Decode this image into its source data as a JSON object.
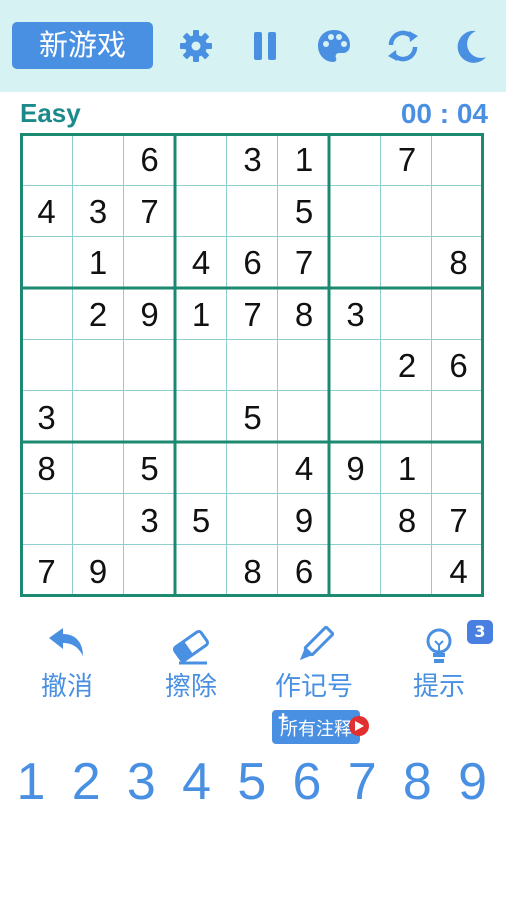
{
  "header": {
    "new_game_label": "新游戏",
    "icons": [
      "gear-icon",
      "pause-icon",
      "palette-icon",
      "refresh-icon",
      "moon-icon"
    ]
  },
  "status": {
    "level": "Easy",
    "timer": "00 : 04"
  },
  "board": {
    "rows": [
      [
        "",
        "",
        "6",
        "",
        "3",
        "1",
        "",
        "7",
        ""
      ],
      [
        "4",
        "3",
        "7",
        "",
        "",
        "5",
        "",
        "",
        ""
      ],
      [
        "",
        "1",
        "",
        "4",
        "6",
        "7",
        "",
        "",
        "8"
      ],
      [
        "",
        "2",
        "9",
        "1",
        "7",
        "8",
        "3",
        "",
        ""
      ],
      [
        "",
        "",
        "",
        "",
        "",
        "",
        "",
        "2",
        "6"
      ],
      [
        "3",
        "",
        "",
        "",
        "5",
        "",
        "",
        "",
        ""
      ],
      [
        "8",
        "",
        "5",
        "",
        "",
        "4",
        "9",
        "1",
        ""
      ],
      [
        "",
        "",
        "3",
        "5",
        "",
        "9",
        "",
        "8",
        "7"
      ],
      [
        "7",
        "9",
        "",
        "",
        "8",
        "6",
        "",
        "",
        "4"
      ]
    ]
  },
  "toolbar": {
    "undo": "撤消",
    "erase": "擦除",
    "notes": "作记号",
    "hint": "提示",
    "hint_count": "3"
  },
  "notes_chip": {
    "label": "所有注释"
  },
  "digits": [
    "1",
    "2",
    "3",
    "4",
    "5",
    "6",
    "7",
    "8",
    "9"
  ],
  "colors": {
    "accent": "#4a90e2",
    "grid": "#1c8a70",
    "topbar": "#d6f2f2"
  }
}
